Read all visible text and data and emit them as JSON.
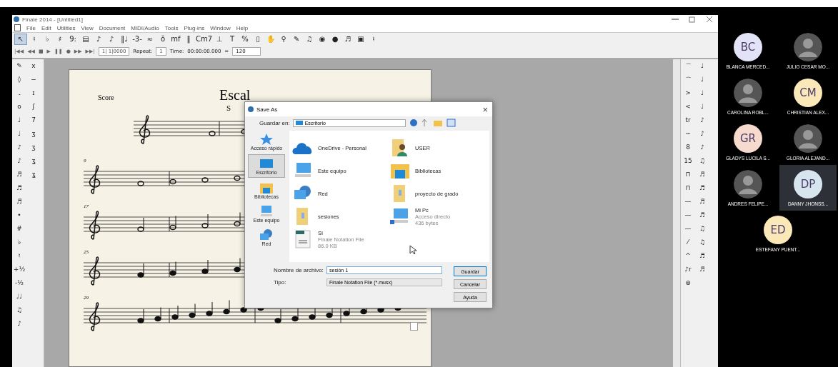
{
  "window": {
    "title": "Finale 2014 - [Untitled1]"
  },
  "menu": [
    "File",
    "Edit",
    "Utilities",
    "View",
    "Document",
    "MIDI/Audio",
    "Tools",
    "Plug-ins",
    "Window",
    "Help"
  ],
  "tools": [
    {
      "glyph": "↖",
      "selected": true
    },
    {
      "glyph": "♮",
      "selected": false
    },
    {
      "glyph": "♭",
      "selected": false
    },
    {
      "glyph": "♯",
      "selected": false
    },
    {
      "glyph": "9:",
      "selected": false
    },
    {
      "glyph": "▤",
      "selected": false
    },
    {
      "glyph": "♪",
      "selected": false
    },
    {
      "glyph": "♪",
      "selected": false
    },
    {
      "glyph": "‖♩",
      "selected": false
    },
    {
      "glyph": "-3-",
      "selected": false
    },
    {
      "glyph": "≈",
      "selected": false
    },
    {
      "glyph": "ŏ",
      "selected": false
    },
    {
      "glyph": "mf",
      "selected": false
    },
    {
      "glyph": "‖",
      "selected": false
    },
    {
      "glyph": "Cm7",
      "selected": false
    },
    {
      "glyph": "⊥",
      "selected": false
    },
    {
      "glyph": "T",
      "selected": false
    },
    {
      "glyph": "%",
      "selected": false
    },
    {
      "glyph": "▯",
      "selected": false
    },
    {
      "glyph": "✋",
      "selected": false
    },
    {
      "glyph": "⚲",
      "selected": false
    },
    {
      "glyph": "✎",
      "selected": false
    },
    {
      "glyph": "♫",
      "selected": false
    },
    {
      "glyph": "◉",
      "selected": false
    },
    {
      "glyph": "●",
      "selected": false
    },
    {
      "glyph": "♬",
      "selected": false
    },
    {
      "glyph": "▣",
      "selected": false
    },
    {
      "glyph": "♮",
      "selected": false
    }
  ],
  "transport": [
    "|◀◀",
    "◀◀",
    "■",
    "▶",
    "❚❚",
    "●",
    "▶▶",
    "▶▶|"
  ],
  "playback": {
    "position": "1| 1|0000",
    "repeat_label": "Repeat:",
    "repeat": "1",
    "time_label": "Time:",
    "time": "00:00:00.000",
    "equals": "=",
    "tempo": "120"
  },
  "left_palette": [
    [
      "✎",
      "x"
    ],
    [
      "◊",
      "−"
    ],
    [
      "𝅘",
      "ɪ"
    ],
    [
      "o",
      "ʃ"
    ],
    [
      "♩",
      "7"
    ],
    [
      "♩",
      "ʒ"
    ],
    [
      "♪",
      "ʒ"
    ],
    [
      "♪",
      "ʓ"
    ],
    [
      "♬",
      "ʓ"
    ],
    [
      "♬"
    ],
    [
      "♬"
    ],
    [
      "•"
    ],
    [
      "#"
    ],
    [
      "♭"
    ],
    [
      "♮"
    ],
    [
      "+½"
    ],
    [
      "-½"
    ],
    [
      "♩♩"
    ],
    [
      "♫"
    ],
    [
      "♪"
    ]
  ],
  "right_palette": [
    [
      "⌒",
      "♩"
    ],
    [
      "⌒",
      "♩"
    ],
    [
      ">",
      "♩"
    ],
    [
      "<",
      "♩"
    ],
    [
      "tr",
      "♪"
    ],
    [
      "~",
      "♪"
    ],
    [
      "8",
      "♪"
    ],
    [
      "15",
      "♫"
    ],
    [
      "⊓",
      "♬"
    ],
    [
      "⊓",
      "♬"
    ],
    [
      "—",
      "♬"
    ],
    [
      "—",
      "♬"
    ],
    [
      "—",
      "♫"
    ],
    [
      "⁄",
      "♫"
    ],
    [
      "^",
      "♬"
    ],
    [
      "♪r",
      "♬"
    ],
    [
      "⊛"
    ]
  ],
  "score": {
    "label": "Score",
    "title": "Escal",
    "subtitle": "S",
    "measures": [
      "9",
      "17",
      "25",
      "29"
    ]
  },
  "dialog": {
    "title": "Save As",
    "close": "×",
    "location_label": "Guardar en:",
    "location": "Escritorio",
    "places": [
      {
        "kind": "star",
        "label": "Acceso rápido",
        "selected": false
      },
      {
        "kind": "desktop",
        "label": "Escritorio",
        "selected": true
      },
      {
        "kind": "library",
        "label": "Bibliotecas",
        "selected": false
      },
      {
        "kind": "computer",
        "label": "Este equipo",
        "selected": false
      },
      {
        "kind": "network",
        "label": "Red",
        "selected": false
      }
    ],
    "items": [
      {
        "kind": "cloud",
        "name": "OneDrive - Personal"
      },
      {
        "kind": "computer",
        "name": "Este equipo"
      },
      {
        "kind": "network",
        "name": "Red"
      },
      {
        "kind": "folder",
        "name": "sesiones"
      },
      {
        "kind": "file",
        "name": "SI",
        "detail": "Finale Notation File",
        "size": "86.0 KB"
      },
      {
        "kind": "user",
        "name": "USER"
      },
      {
        "kind": "library",
        "name": "Bibliotecas"
      },
      {
        "kind": "folder",
        "name": "proyecto de grado"
      },
      {
        "kind": "shortcut",
        "name": "Mi Pc",
        "detail": "Acceso directo",
        "size": "436 bytes"
      }
    ],
    "filename_label": "Nombre de archivo:",
    "filename": "sesión 1",
    "type_label": "Tipo:",
    "type": "Finale Notation File (*.musx)",
    "buttons": [
      "Guardar",
      "Cancelar",
      "Ayuda"
    ]
  },
  "participants": [
    {
      "name": "BLANCA MERCED...",
      "kind": "initials",
      "initials": "BC",
      "color": "#e2e3f6",
      "speaking": false
    },
    {
      "name": "JULIO CESAR MO...",
      "kind": "photo",
      "speaking": false
    },
    {
      "name": "CAROLINA  ROBL...",
      "kind": "photo",
      "speaking": false
    },
    {
      "name": "CHRISTIAN ALEX...",
      "kind": "initials",
      "initials": "CM",
      "color": "#fbe8b8",
      "speaking": false
    },
    {
      "name": "GLADYS LUCILA S...",
      "kind": "initials",
      "initials": "GR",
      "color": "#f6dacd",
      "speaking": false
    },
    {
      "name": "GLORIA ALEJAND...",
      "kind": "photo",
      "speaking": false
    },
    {
      "name": "ANDRES FELIPE...",
      "kind": "photo",
      "speaking": false
    },
    {
      "name": "DANNY  JHONSS...",
      "kind": "initials",
      "initials": "DP",
      "color": "#d7e5ef",
      "speaking": true
    },
    {
      "name": "ESTEFANY PUENT...",
      "kind": "initials",
      "initials": "ED",
      "color": "#fbe8b8",
      "speaking": false
    }
  ]
}
